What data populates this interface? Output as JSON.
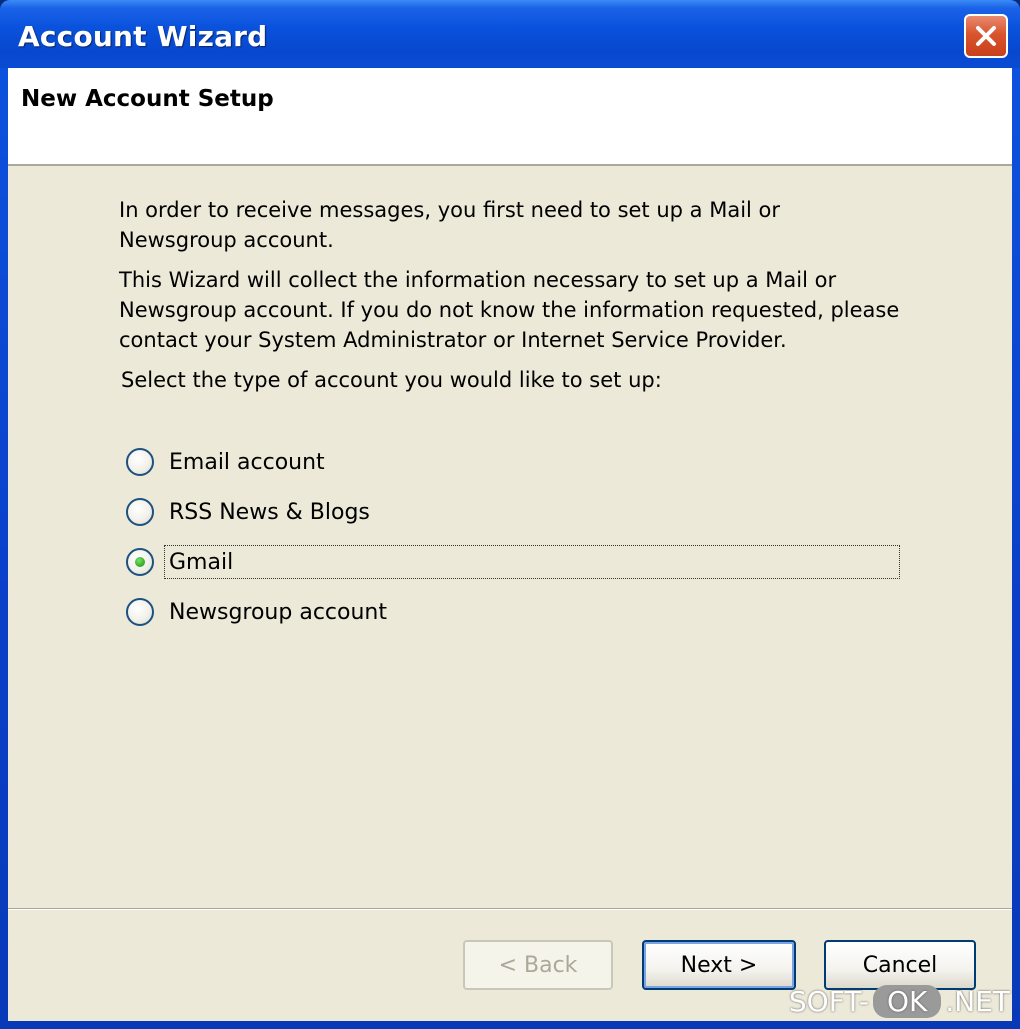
{
  "window": {
    "title": "Account Wizard"
  },
  "header": {
    "title": "New Account Setup"
  },
  "body": {
    "paragraph1": "In order to receive messages, you first need to set up a Mail or Newsgroup account.",
    "paragraph2": "This Wizard will collect the information necessary to set up a Mail or Newsgroup account. If you do not know the information requested, please contact your System Administrator or Internet Service Provider.",
    "prompt": "Select the type of account you would like to set up:"
  },
  "options": [
    {
      "label": "Email account",
      "checked": false
    },
    {
      "label": "RSS News & Blogs",
      "checked": false
    },
    {
      "label": "Gmail",
      "checked": true
    },
    {
      "label": "Newsgroup account",
      "checked": false
    }
  ],
  "buttons": {
    "back": "< Back",
    "next": "Next >",
    "cancel": "Cancel"
  },
  "watermark": {
    "left": "SOFT-",
    "pill": "OK",
    "right": ".NET"
  },
  "colors": {
    "titlebar": "#0a52dc",
    "client_bg": "#ece9d8",
    "close_button": "#d9542e",
    "radio_checked_dot": "#2ea823"
  },
  "icons": {
    "close": "close-x-icon"
  }
}
